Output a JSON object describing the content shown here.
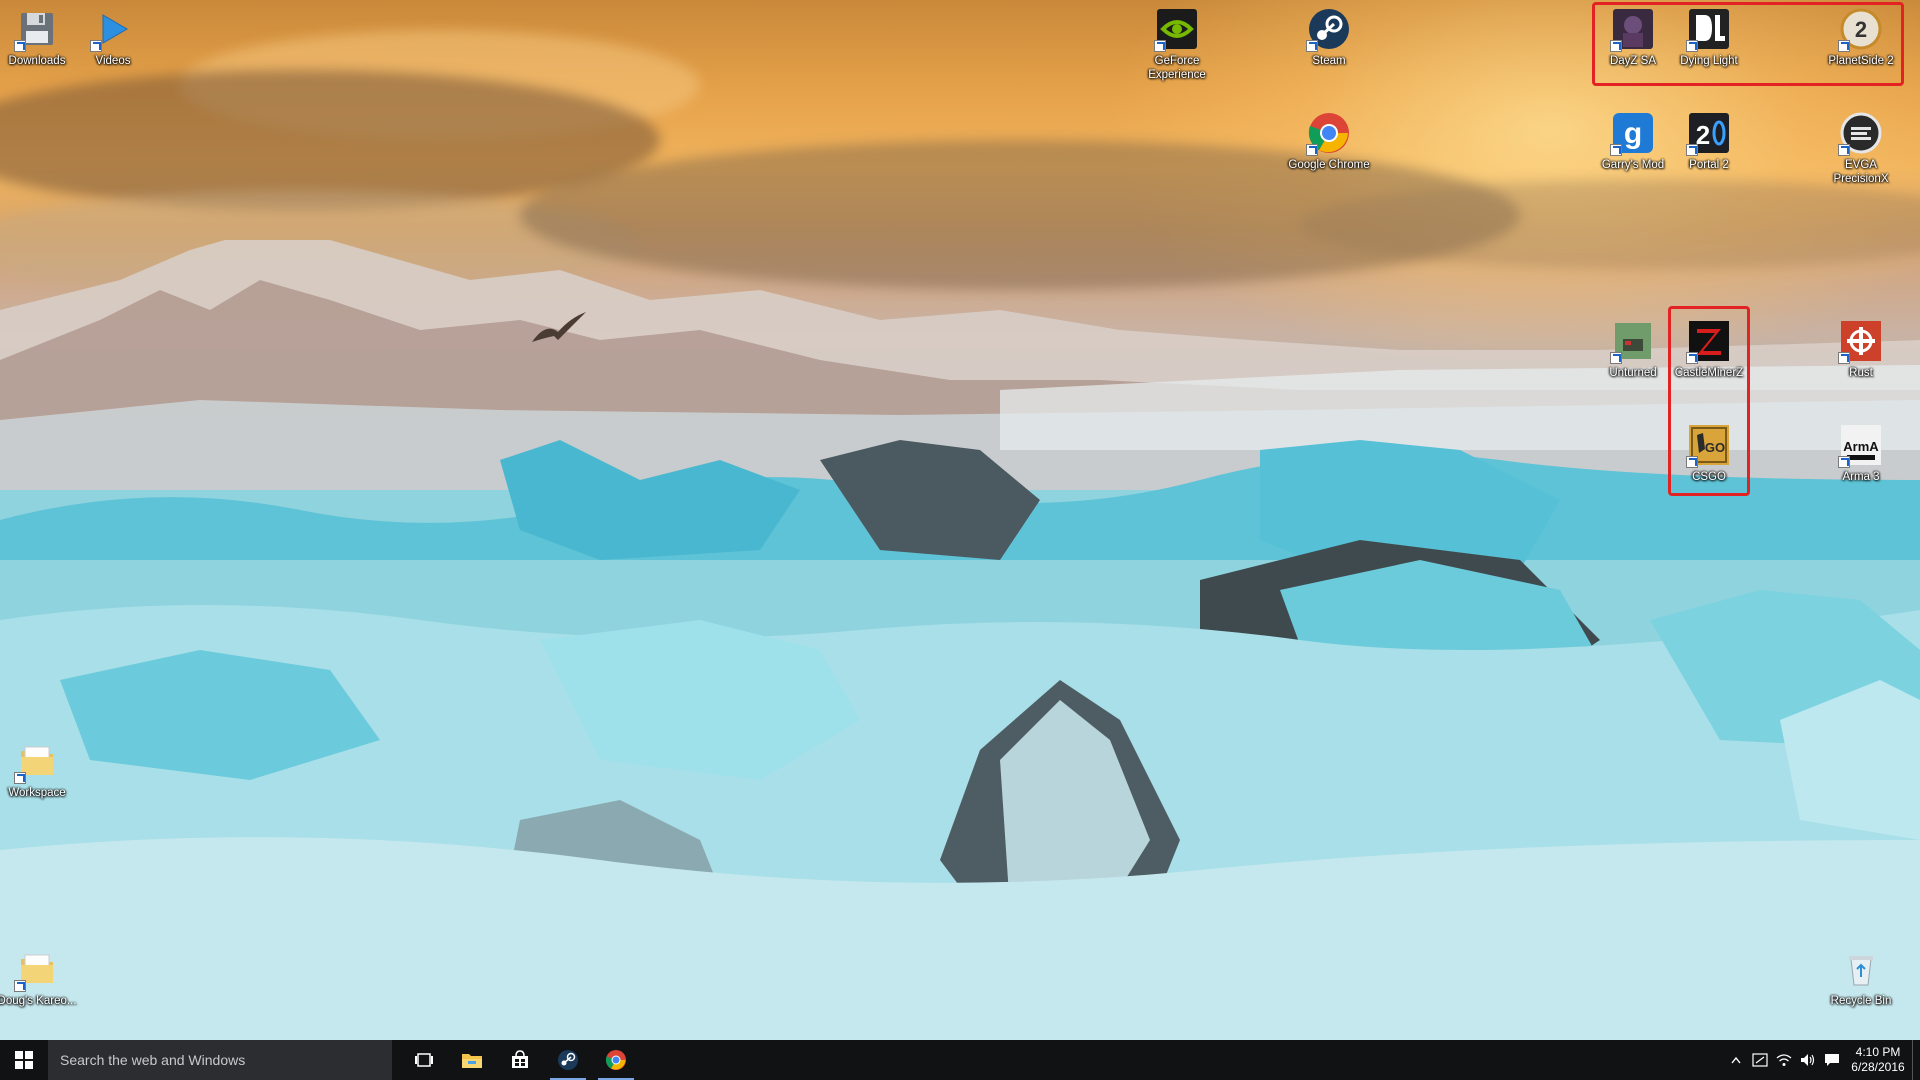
{
  "desktop": {
    "icons": {
      "downloads": "Downloads",
      "videos": "Videos",
      "geforce": "GeForce Experience",
      "steam": "Steam",
      "chrome": "Google Chrome",
      "dayz": "DayZ SA",
      "dying_light": "Dying Light",
      "planetside": "PlanetSide 2",
      "garrys_mod": "Garry's Mod",
      "portal2": "Portal 2",
      "evga": "EVGA PrecisionX",
      "unturned": "Unturned",
      "castleminerz": "CastleMinerZ",
      "rust": "Rust",
      "csgo": "CSGO",
      "arma3": "Arma 3",
      "workspace": "Workspace",
      "dougs_kareo": "Doug's Kareo...",
      "recycle_bin": "Recycle Bin"
    },
    "highlight_color": "#e32323"
  },
  "taskbar": {
    "search_placeholder": "Search the web and Windows",
    "pinned": [
      "task-view-icon",
      "file-explorer-icon",
      "store-icon",
      "steam-icon",
      "chrome-icon"
    ],
    "clock_time": "4:10 PM",
    "clock_date": "6/28/2016"
  }
}
